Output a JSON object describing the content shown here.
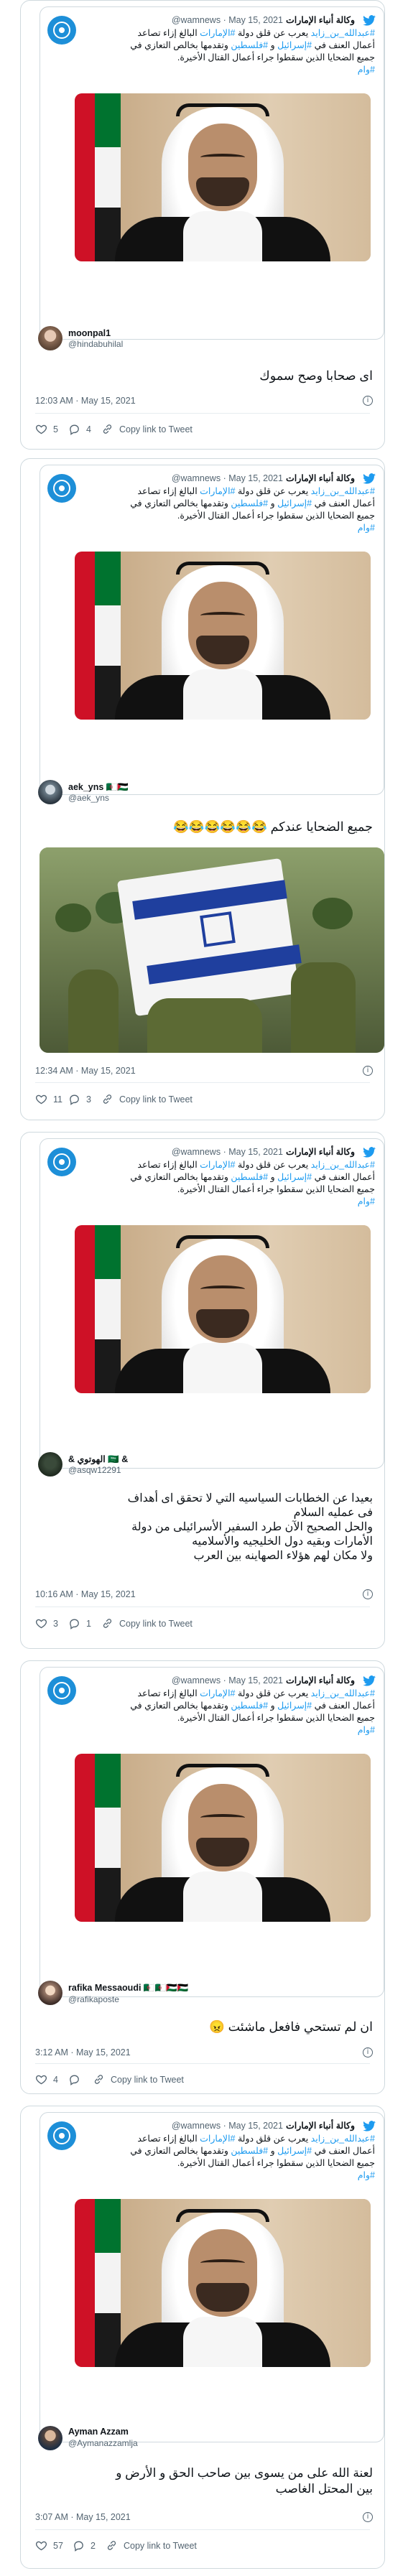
{
  "colors": {
    "accent": "#1d9bf0",
    "text": "#0f1419",
    "muted": "#536471",
    "border": "#cfd9de"
  },
  "quoted_tweet": {
    "name": "وكالة أنباء الإمارات",
    "handle": "@wamnews",
    "date": "· May 15, 2021",
    "text_line1_hash": "#عبدالله_بن_زايد",
    "text_line1_rest": " يعرب عن قلق دولة ",
    "text_line1_hash2": "#الإمارات",
    "text_line1_end": " البالغ إزاء تصاعد",
    "text_line2a": "أعمال العنف في ",
    "text_line2_hash": "#إسرائيل",
    "text_line2b": " و ",
    "text_line2_hash2": "#فلسطين",
    "text_line2c": " وتقدمها بخالص التعازي في",
    "text_line3": "جميع الضحايا الذين سقطوا جراء أعمال القتال الأخيرة.",
    "text_line4_hash": "#وام",
    "icons": [
      "wam-logo-icon",
      "twitter-bird-icon"
    ]
  },
  "actions": {
    "copy_label": "Copy link to Tweet"
  },
  "tweets": [
    {
      "name": "moonpal1",
      "handle": "@hindabuhilal",
      "text": "اى صحابا وصح سموك",
      "time": "12:03 AM · May 15, 2021",
      "likes": "5",
      "replies": "4"
    },
    {
      "name": "aek_yns 🇩🇿🇵🇸",
      "handle": "@aek_yns",
      "text": "جميع الضحايا عندكم 😂😂😂😂😂😂",
      "time": "12:34 AM · May 15, 2021",
      "likes": "11",
      "replies": "3"
    },
    {
      "name": "& الهوتوي 🇸🇦 &",
      "handle": "@asqw12291",
      "text_lines": [
        "بعيدا عن الخطابات السياسيه التي لا تحقق اى أهداف",
        "فى عمليه السلام",
        "والحل الصحيح الآن  طرد السفير الأسرائيلى من دولة",
        "الأمارات وبقيه دول الخليجيه والأسلاميه",
        "ولا مكان لهم هؤلاء الصهاينه بين العرب"
      ],
      "time": "10:16 AM · May 15, 2021",
      "likes": "3",
      "replies": "1"
    },
    {
      "name": "rafika Messaoudi 🇩🇿🇩🇿🇵🇸🇵🇸",
      "handle": "@rafikaposte",
      "text": "ان لم تستحي فافعل ماشئت 😠",
      "time": "3:12 AM · May 15, 2021",
      "likes": "4",
      "replies": ""
    },
    {
      "name": "Ayman Azzam",
      "handle": "@Aymanazzamlja",
      "text_lines": [
        "لعنة الله على من يسوى بين صاحب الحق و الأرض و",
        "بين المحتل الغاصب"
      ],
      "time": "3:07 AM · May 15, 2021",
      "likes": "57",
      "replies": "2"
    }
  ]
}
